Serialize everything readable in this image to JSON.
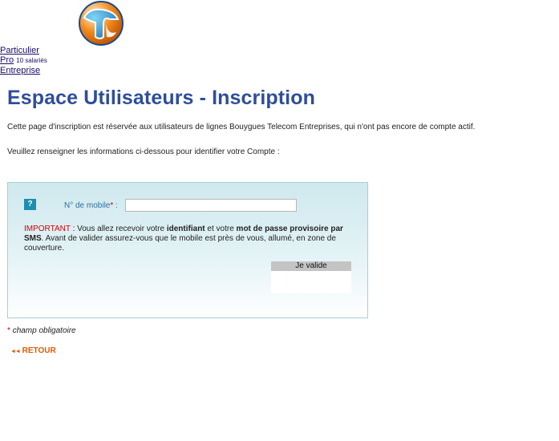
{
  "header": {
    "logo_icon": "bouygues-telecom-logo",
    "segments": [
      {
        "label": "Particulier",
        "sub": ""
      },
      {
        "label": "Pro",
        "sub": "10 salariés"
      },
      {
        "label": "Entreprise",
        "sub": ""
      }
    ]
  },
  "main": {
    "title": "Espace Utilisateurs - Inscription",
    "intro": "Cette page d'inscription est réservée aux utilisateurs de lignes Bouygues Telecom Entreprises, qui n'ont pas encore de compte actif.",
    "instruction": "Veuillez renseigner les informations ci-dessous pour identifier votre Compte :"
  },
  "form": {
    "help_label": "?",
    "mobile_label": "N° de mobile",
    "required_mark": "*",
    "label_suffix": " :",
    "mobile_value": "",
    "important_word": "IMPORTANT",
    "important_p1": " : Vous allez recevoir votre ",
    "important_b1": "identifiant",
    "important_p2": " et votre ",
    "important_b2": "mot de passe provisoire par SMS",
    "important_p3": ". Avant de valider assurez-vous que le mobile est près de vous, allumé, en zone de couverture.",
    "submit_label": "Je valide"
  },
  "footer": {
    "required_legend": "champ obligatoire",
    "required_mark": "*",
    "back_arrows": "◄◄",
    "back_label": "RETOUR"
  },
  "colors": {
    "title": "#2f4d9a",
    "accent_red": "#d40000",
    "back_orange": "#e05a00"
  }
}
